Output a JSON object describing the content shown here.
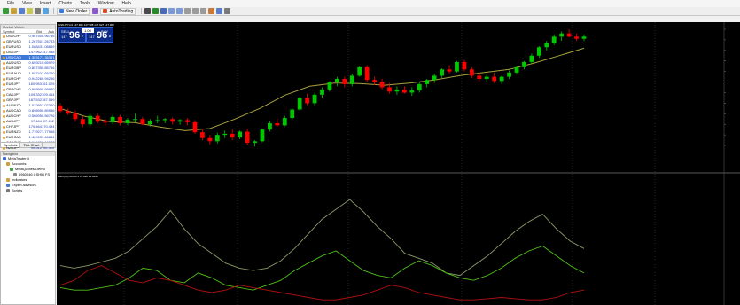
{
  "menu": [
    "File",
    "View",
    "Insert",
    "Charts",
    "Tools",
    "Window",
    "Help"
  ],
  "toolbar": {
    "new_order": "New Order",
    "autotrading": "AutoTrading"
  },
  "market_watch": {
    "title": "Market Watch",
    "headers": {
      "symbol": "Symbol",
      "bid": "Bid",
      "ask": "Ask"
    },
    "rows": [
      {
        "symbol": "USDCHF",
        "bid": "0.96750",
        "ask": "0.96786"
      },
      {
        "symbol": "GBPUSD",
        "bid": "1.26750",
        "ask": "1.26783"
      },
      {
        "symbol": "EURUSD",
        "bid": "1.08843",
        "ask": "1.08869"
      },
      {
        "symbol": "USDJPY",
        "bid": "147.962",
        "ask": "147.988"
      },
      {
        "symbol": "USDCAD",
        "bid": "1.35317",
        "ask": "1.35351"
      },
      {
        "symbol": "AUDUSD",
        "bid": "0.65921",
        "ask": "0.65979"
      },
      {
        "symbol": "EURGBP",
        "bid": "0.85735",
        "ask": "0.85766"
      },
      {
        "symbol": "EURAUD",
        "bid": "1.65742",
        "ask": "1.65790"
      },
      {
        "symbol": "EURCHF",
        "bid": "0.94226",
        "ask": "0.94266"
      },
      {
        "symbol": "EURJPY",
        "bid": "160.953",
        "ask": "161.025"
      },
      {
        "symbol": "GBPCHF",
        "bid": "0.99950",
        "ask": "0.99990"
      },
      {
        "symbol": "CADJPY",
        "bid": "109.332",
        "ask": "109.414"
      },
      {
        "symbol": "GBPJPY",
        "bid": "187.532",
        "ask": "187.599"
      },
      {
        "symbol": "AUDNZD",
        "bid": "1.07290",
        "ask": "1.07370"
      },
      {
        "symbol": "AUDCAD",
        "bid": "0.89895",
        "ask": "0.89936"
      },
      {
        "symbol": "AUDCHF",
        "bid": "0.56695",
        "ask": "0.56726"
      },
      {
        "symbol": "AUDJPY",
        "bid": "97.464",
        "ask": "97.492"
      },
      {
        "symbol": "CHFJPY",
        "bid": "170.464",
        "ask": "170.494"
      },
      {
        "symbol": "EURNZD",
        "bid": "1.77927",
        "ask": "1.77968"
      },
      {
        "symbol": "EURCAD",
        "bid": "1.46993",
        "ask": "1.46884"
      },
      {
        "symbol": "CADCHF",
        "bid": "0.66485",
        "ask": "0.66577"
      },
      {
        "symbol": "NZDJPY",
        "bid": "90.312",
        "ask": "90.360"
      },
      {
        "symbol": "NZDUSD",
        "bid": "0.61970",
        "ask": "0.61885"
      }
    ],
    "selected_index": 4,
    "tabs": [
      "Symbols",
      "Tick Chart"
    ]
  },
  "navigator": {
    "title": "Navigator",
    "items": [
      {
        "label": "MetaTrader 4",
        "indent": 0
      },
      {
        "label": "Accounts",
        "indent": 1
      },
      {
        "label": "MetaQuotes-Demo",
        "indent": 2
      },
      {
        "label": "1960046 CSHIB FS",
        "indent": 3
      },
      {
        "label": "Indicators",
        "indent": 1
      },
      {
        "label": "Expert Advisors",
        "indent": 1
      },
      {
        "label": "Scripts",
        "indent": 1
      }
    ]
  },
  "chart": {
    "header_text": "USDJPY,H1  147.962 147.988 147.927 147.962",
    "indicator_text": "ADX(14) 29.8875 11.622 14.9445",
    "one_click": {
      "sell_label": "SELL",
      "buy_label": "BUY",
      "lot": "1.00",
      "sell_prefix": "147",
      "sell_big": "96",
      "sell_sup": "2",
      "buy_prefix": "147",
      "buy_big": "96",
      "buy_sup": "8"
    },
    "colors": {
      "bull": "#00c800",
      "bear": "#ff0000",
      "ma": "#a7a23d",
      "adx": "#8a9a6a",
      "plus_di": "#4fbf1a",
      "minus_di": "#b01010",
      "grid": "#3a3a3a"
    }
  },
  "chart_data": {
    "type": "candlestick",
    "candles": [
      [
        147.35,
        147.4,
        147.22,
        147.25
      ],
      [
        147.25,
        147.3,
        147.18,
        147.2
      ],
      [
        147.2,
        147.26,
        147.05,
        147.1
      ],
      [
        147.1,
        147.16,
        146.95,
        147.0
      ],
      [
        147.0,
        147.2,
        146.96,
        147.16
      ],
      [
        147.16,
        147.2,
        147.02,
        147.05
      ],
      [
        147.05,
        147.1,
        146.98,
        147.04
      ],
      [
        147.04,
        147.18,
        147.0,
        147.14
      ],
      [
        147.14,
        147.18,
        146.98,
        147.02
      ],
      [
        147.02,
        147.12,
        146.98,
        147.09
      ],
      [
        147.09,
        147.2,
        147.04,
        147.1
      ],
      [
        147.1,
        147.14,
        146.98,
        147.0
      ],
      [
        147.0,
        147.1,
        146.96,
        147.06
      ],
      [
        147.06,
        147.16,
        147.02,
        147.08
      ],
      [
        147.08,
        147.12,
        147.02,
        147.1
      ],
      [
        147.1,
        147.13,
        147.0,
        147.05
      ],
      [
        147.05,
        147.1,
        146.99,
        147.08
      ],
      [
        147.08,
        147.12,
        146.98,
        147.04
      ],
      [
        147.04,
        147.08,
        146.82,
        146.85
      ],
      [
        146.85,
        146.92,
        146.7,
        146.74
      ],
      [
        146.74,
        146.8,
        146.62,
        146.68
      ],
      [
        146.68,
        146.84,
        146.64,
        146.8
      ],
      [
        146.8,
        146.88,
        146.74,
        146.82
      ],
      [
        146.82,
        146.9,
        146.7,
        146.75
      ],
      [
        146.75,
        146.88,
        146.72,
        146.86
      ],
      [
        146.86,
        146.92,
        146.6,
        146.65
      ],
      [
        146.65,
        146.7,
        146.58,
        146.68
      ],
      [
        146.68,
        146.92,
        146.66,
        146.9
      ],
      [
        146.9,
        147.06,
        146.86,
        147.02
      ],
      [
        147.02,
        147.1,
        146.96,
        146.98
      ],
      [
        146.98,
        147.16,
        146.96,
        147.12
      ],
      [
        147.12,
        147.3,
        147.08,
        147.28
      ],
      [
        147.28,
        147.52,
        147.26,
        147.5
      ],
      [
        147.5,
        147.58,
        147.36,
        147.4
      ],
      [
        147.4,
        147.6,
        147.36,
        147.56
      ],
      [
        147.56,
        147.7,
        147.5,
        147.66
      ],
      [
        147.66,
        147.82,
        147.62,
        147.8
      ],
      [
        147.8,
        147.9,
        147.72,
        147.86
      ],
      [
        147.86,
        147.9,
        147.7,
        147.76
      ],
      [
        147.76,
        147.96,
        147.72,
        147.92
      ],
      [
        147.92,
        148.1,
        147.9,
        148.08
      ],
      [
        148.08,
        148.12,
        147.8,
        147.84
      ],
      [
        147.84,
        147.9,
        147.74,
        147.8
      ],
      [
        147.8,
        147.86,
        147.66,
        147.7
      ],
      [
        147.7,
        147.78,
        147.58,
        147.62
      ],
      [
        147.62,
        147.72,
        147.56,
        147.66
      ],
      [
        147.66,
        147.72,
        147.58,
        147.6
      ],
      [
        147.6,
        147.7,
        147.54,
        147.64
      ],
      [
        147.64,
        147.8,
        147.6,
        147.76
      ],
      [
        147.76,
        147.86,
        147.7,
        147.84
      ],
      [
        147.84,
        147.96,
        147.78,
        147.92
      ],
      [
        147.92,
        148.06,
        147.88,
        148.04
      ],
      [
        148.04,
        148.12,
        147.96,
        148.0
      ],
      [
        148.0,
        148.2,
        147.98,
        148.18
      ],
      [
        148.18,
        148.22,
        148.0,
        148.04
      ],
      [
        148.04,
        148.08,
        147.88,
        147.92
      ],
      [
        147.92,
        147.98,
        147.82,
        147.86
      ],
      [
        147.86,
        147.94,
        147.8,
        147.9
      ],
      [
        147.9,
        147.98,
        147.78,
        147.82
      ],
      [
        147.82,
        147.92,
        147.76,
        147.9
      ],
      [
        147.9,
        148.02,
        147.86,
        147.98
      ],
      [
        147.98,
        148.1,
        147.94,
        148.08
      ],
      [
        148.08,
        148.2,
        148.04,
        148.18
      ],
      [
        148.18,
        148.34,
        148.14,
        148.3
      ],
      [
        148.3,
        148.48,
        148.26,
        148.46
      ],
      [
        148.46,
        148.58,
        148.4,
        148.54
      ],
      [
        148.54,
        148.7,
        148.5,
        148.66
      ],
      [
        148.66,
        148.76,
        148.58,
        148.72
      ],
      [
        148.72,
        148.8,
        148.64,
        148.66
      ],
      [
        148.66,
        148.72,
        148.58,
        148.62
      ],
      [
        148.62,
        148.7,
        148.58,
        148.66
      ]
    ],
    "ma": [
      147.3,
      147.15,
      147.05,
      147.03,
      146.95,
      146.88,
      146.92,
      147.1,
      147.3,
      147.55,
      147.72,
      147.78,
      147.77,
      147.74,
      147.78,
      147.84,
      147.92,
      147.98,
      148.04,
      148.16,
      148.3,
      148.44
    ],
    "y_range": [
      146.5,
      148.85
    ],
    "adx": [
      30,
      28,
      30,
      33,
      36,
      42,
      52,
      62,
      75,
      60,
      48,
      40,
      32,
      28,
      26,
      28,
      34,
      44,
      56,
      68,
      76,
      84,
      74,
      62,
      52,
      40,
      36,
      32,
      24,
      22,
      30,
      38,
      48,
      58,
      66,
      72,
      60,
      50,
      44
    ],
    "plus_di": [
      12,
      10,
      10,
      12,
      14,
      20,
      28,
      26,
      18,
      16,
      24,
      20,
      14,
      12,
      10,
      14,
      18,
      26,
      32,
      38,
      42,
      34,
      26,
      22,
      20,
      28,
      34,
      30,
      24,
      20,
      18,
      22,
      28,
      36,
      42,
      46,
      38,
      30,
      24
    ],
    "minus_di": [
      14,
      18,
      26,
      30,
      24,
      18,
      16,
      20,
      18,
      14,
      10,
      8,
      10,
      14,
      12,
      10,
      8,
      6,
      4,
      2,
      2,
      4,
      6,
      10,
      14,
      12,
      8,
      6,
      4,
      2,
      2,
      3,
      4,
      3,
      2,
      2,
      4,
      8,
      10
    ],
    "adx_range": [
      0,
      100
    ]
  }
}
